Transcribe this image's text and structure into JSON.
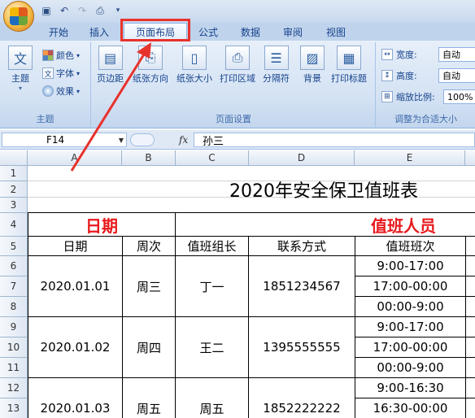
{
  "qat": {
    "icons": [
      "save-icon",
      "undo-icon",
      "redo-icon",
      "print-preview-icon",
      "quick-access-dropdown-icon"
    ]
  },
  "tabs": [
    "开始",
    "插入",
    "页面布局",
    "公式",
    "数据",
    "审阅",
    "视图"
  ],
  "active_tab": "页面布局",
  "ribbon": {
    "theme_group": {
      "label": "主题",
      "big": "主题",
      "small": [
        "颜色",
        "字体",
        "效果"
      ]
    },
    "page_setup_group": {
      "label": "页面设置",
      "buttons": [
        "页边距",
        "纸张方向",
        "纸张大小",
        "打印区域",
        "分隔符",
        "背景",
        "打印标题"
      ]
    },
    "fit_group": {
      "label": "调整为合适大小",
      "width_label": "宽度:",
      "width_value": "自动",
      "height_label": "高度:",
      "height_value": "自动",
      "scale_label": "缩放比例:",
      "scale_value": "100%"
    }
  },
  "formula_bar": {
    "name_box": "F14",
    "fx": "fx",
    "content": "孙三"
  },
  "columns": [
    "A",
    "B",
    "C",
    "D",
    "E"
  ],
  "rows": [
    "1",
    "2",
    "3",
    "4",
    "5",
    "6",
    "7",
    "8",
    "9",
    "10",
    "11",
    "12",
    "13"
  ],
  "sheet": {
    "title": "2020年安全保卫值班表",
    "header_date": "日期",
    "header_staff": "值班人员",
    "subheaders": [
      "日期",
      "周次",
      "值班组长",
      "联系方式",
      "值班班次"
    ],
    "entries": [
      {
        "date": "2020.01.01",
        "week": "周三",
        "leader": "丁一",
        "phone": "1851234567",
        "shifts": [
          "9:00-17:00",
          "17:00-00:00",
          "00:00-9:00"
        ]
      },
      {
        "date": "2020.01.02",
        "week": "周四",
        "leader": "王二",
        "phone": "1395555555",
        "shifts": [
          "9:00-17:00",
          "17:00-00:00",
          "00:00-9:00"
        ]
      },
      {
        "date": "2020.01.03",
        "week": "周五",
        "leader": "周五",
        "phone": "1852222222",
        "shifts": [
          "9:00-16:30",
          "16:30-00:00"
        ]
      }
    ]
  },
  "colors": {
    "annotation_red": "#e8322c",
    "header_red": "#e8191c"
  }
}
